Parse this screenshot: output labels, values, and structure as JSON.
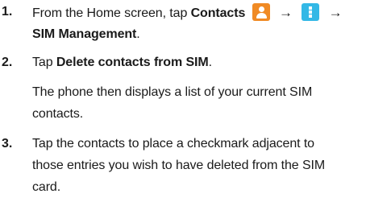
{
  "steps": [
    {
      "number": "1.",
      "line1_prefix": "From the Home screen, tap ",
      "line1_bold": "Contacts",
      "arrow": "→",
      "line2_bold": "SIM Management",
      "line2_suffix": "."
    },
    {
      "number": "2.",
      "line1_prefix": "Tap ",
      "line1_bold": "Delete contacts from SIM",
      "line1_suffix": ".",
      "line2": "The phone then displays a list of your current SIM",
      "line3": "contacts."
    },
    {
      "number": "3.",
      "line1": "Tap the contacts to place a checkmark adjacent to",
      "line2": "those entries you wish to have deleted from the SIM",
      "line3": "card."
    }
  ],
  "icons": [
    "contacts-app-icon",
    "menu-icon"
  ],
  "colors": {
    "contacts_icon": "#f08a24",
    "menu_icon": "#33b8e6"
  }
}
